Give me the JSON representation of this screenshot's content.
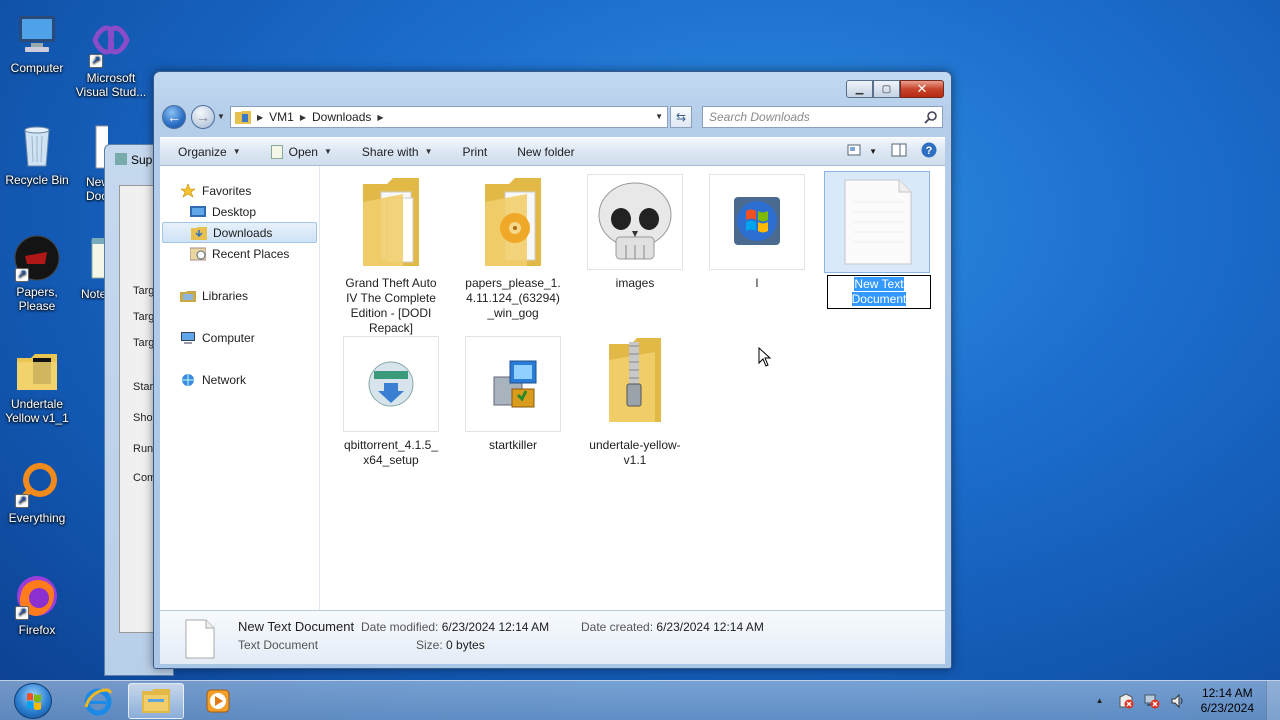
{
  "desktop": {
    "icons": [
      {
        "label": "Computer"
      },
      {
        "label": "Microsoft Visual Stud..."
      },
      {
        "label": "Recycle Bin"
      },
      {
        "label": "New Doc"
      },
      {
        "label": "Papers, Please"
      },
      {
        "label": "Note"
      },
      {
        "label": "Undertale Yellow v1_1"
      },
      {
        "label": "Everything"
      },
      {
        "label": "Firefox"
      }
    ]
  },
  "background_window": {
    "title": "Sup",
    "rows": [
      "Targ",
      "Targ",
      "Targ",
      "Start",
      "Sho",
      "Run",
      "Com"
    ]
  },
  "explorer": {
    "caption": {
      "minimize": "▁",
      "maximize": "▢",
      "close": "✕"
    },
    "breadcrumb": [
      "VM1",
      "Downloads"
    ],
    "search_placeholder": "Search Downloads",
    "toolbar": {
      "organize": "Organize",
      "open": "Open",
      "share_with": "Share with",
      "print": "Print",
      "new_folder": "New folder"
    },
    "nav": {
      "favorites": "Favorites",
      "desktop": "Desktop",
      "downloads": "Downloads",
      "recent_places": "Recent Places",
      "libraries": "Libraries",
      "computer": "Computer",
      "network": "Network"
    },
    "files": [
      {
        "name": "Grand Theft Auto IV The Complete Edition - [DODI Repack]",
        "kind": "folder"
      },
      {
        "name": "papers_please_1.4.11.124_(63294)_win_gog",
        "kind": "folder-cd"
      },
      {
        "name": "images",
        "kind": "skull"
      },
      {
        "name": "l",
        "kind": "windows"
      },
      {
        "name": "New Text Document",
        "kind": "text",
        "selected": true
      },
      {
        "name": "qbittorrent_4.1.5_x64_setup",
        "kind": "qbit"
      },
      {
        "name": "startkiller",
        "kind": "installer"
      },
      {
        "name": "undertale-yellow-v1.1",
        "kind": "zip"
      }
    ],
    "details": {
      "name": "New Text Document",
      "type": "Text Document",
      "date_modified_label": "Date modified:",
      "date_modified": "6/23/2024 12:14 AM",
      "date_created_label": "Date created:",
      "date_created": "6/23/2024 12:14 AM",
      "size_label": "Size:",
      "size": "0 bytes"
    }
  },
  "taskbar": {
    "time": "12:14 AM",
    "date": "6/23/2024",
    "tray_expand": "▲"
  }
}
